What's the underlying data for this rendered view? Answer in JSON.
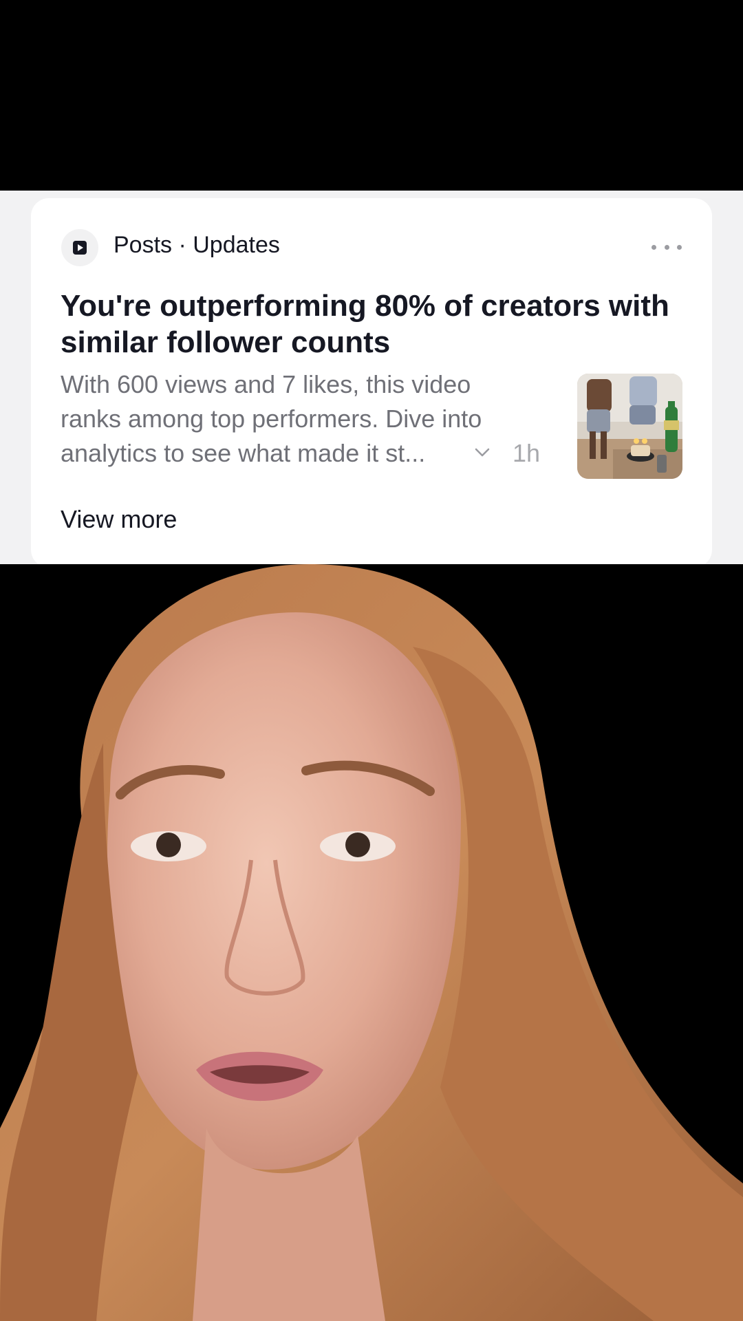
{
  "notification": {
    "source": "Posts · Updates",
    "title": "You're outperforming 80% of creators with similar follower counts",
    "body": "With 600 views and 7 likes, this video ranks among top performers. Dive into analytics to see what made it st...",
    "time": "1h",
    "view_more_label": "View more",
    "icons": {
      "app": "play-square-icon",
      "menu": "more-horizontal-icon",
      "expand": "chevron-down-icon"
    }
  },
  "colors": {
    "background": "#000000",
    "card": "#ffffff",
    "strip": "#f2f2f3",
    "title_text": "#161823",
    "body_text": "#6f7077",
    "muted_text": "#a7a8ac"
  }
}
